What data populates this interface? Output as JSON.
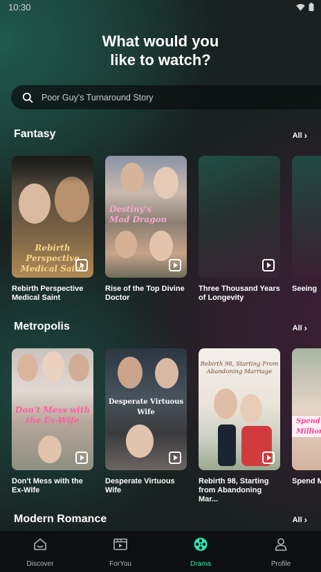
{
  "status": {
    "time": "10:30"
  },
  "headline": {
    "line1": "What would you",
    "line2": "like to watch?"
  },
  "search": {
    "placeholder": "Poor Guy's Turnaround Story"
  },
  "sections": [
    {
      "title": "Fantasy",
      "see_all": "All",
      "items": [
        {
          "label": "Rebirth Perspective Medical Saint",
          "poster_text": "Rebirth Perspective\nMedical Saint"
        },
        {
          "label": "Rise of the Top Divine Doctor",
          "poster_text": "Destiny's\nMad Dragon"
        },
        {
          "label": "Three Thousand Years of Longevity",
          "poster_text": ""
        },
        {
          "label": "Seeing",
          "poster_text": ""
        }
      ]
    },
    {
      "title": "Metropolis",
      "see_all": "All",
      "items": [
        {
          "label": "Don't Mess with the Ex-Wife",
          "poster_text": "Don't Mess with\nthe Ex-Wife"
        },
        {
          "label": "Desperate Virtuous Wife",
          "poster_text": "Desperate Virtuous Wife"
        },
        {
          "label": "Rebirth 98, Starting from Abandoning Mar...",
          "poster_text": "Rebirth 98, Starting From\nAbandoning Marriage"
        },
        {
          "label": "Spend Million",
          "poster_text": "Spend\nMillion"
        }
      ]
    },
    {
      "title": "Modern Romance",
      "see_all": "All"
    }
  ],
  "tabs": [
    {
      "label": "Discover",
      "icon": "home-icon"
    },
    {
      "label": "ForYou",
      "icon": "film-play-icon"
    },
    {
      "label": "Drama",
      "icon": "film-reel-icon",
      "active": true
    },
    {
      "label": "Profile",
      "icon": "person-icon"
    }
  ],
  "colors": {
    "accent": "#2ee6b3",
    "background": "#18211f"
  }
}
